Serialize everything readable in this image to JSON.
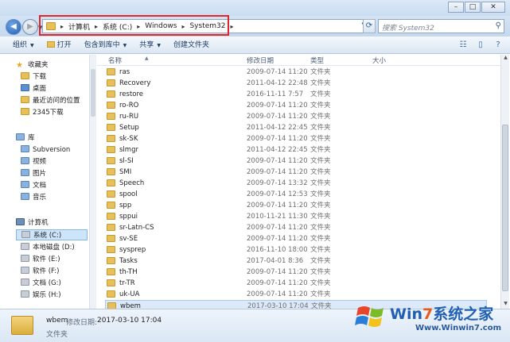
{
  "address": {
    "crumbs": [
      "计算机",
      "系统 (C:)",
      "Windows",
      "System32"
    ]
  },
  "search": {
    "placeholder": "搜索 System32"
  },
  "toolbar": {
    "organize": "组织",
    "open": "打开",
    "include_library": "包含到库中",
    "share": "共享",
    "new_folder": "创建文件夹"
  },
  "nav": {
    "favorites": "收藏夹",
    "downloads": "下载",
    "desktop": "桌面",
    "recent": "最近访问的位置",
    "dl2345": "2345下载",
    "libraries": "库",
    "subversion": "Subversion",
    "videos": "视频",
    "pictures": "图片",
    "documents": "文档",
    "music": "音乐",
    "computer": "计算机",
    "drive_c": "系统 (C:)",
    "drive_d": "本地磁盘 (D:)",
    "drive_e": "软件 (E:)",
    "drive_f": "软件 (F:)",
    "drive_g": "文档 (G:)",
    "drive_h": "娱乐 (H:)"
  },
  "columns": {
    "name": "名称",
    "date": "修改日期",
    "type": "类型",
    "size": "大小"
  },
  "files": [
    {
      "name": "ras",
      "date": "2009-07-14 11:20",
      "type": "文件夹"
    },
    {
      "name": "Recovery",
      "date": "2011-04-12 22:48",
      "type": "文件夹"
    },
    {
      "name": "restore",
      "date": "2016-11-11 7:57",
      "type": "文件夹"
    },
    {
      "name": "ro-RO",
      "date": "2009-07-14 11:20",
      "type": "文件夹"
    },
    {
      "name": "ru-RU",
      "date": "2009-07-14 11:20",
      "type": "文件夹"
    },
    {
      "name": "Setup",
      "date": "2011-04-12 22:45",
      "type": "文件夹"
    },
    {
      "name": "sk-SK",
      "date": "2009-07-14 11:20",
      "type": "文件夹"
    },
    {
      "name": "slmgr",
      "date": "2011-04-12 22:45",
      "type": "文件夹"
    },
    {
      "name": "sl-SI",
      "date": "2009-07-14 11:20",
      "type": "文件夹"
    },
    {
      "name": "SMI",
      "date": "2009-07-14 11:20",
      "type": "文件夹"
    },
    {
      "name": "Speech",
      "date": "2009-07-14 13:32",
      "type": "文件夹"
    },
    {
      "name": "spool",
      "date": "2009-07-14 12:53",
      "type": "文件夹"
    },
    {
      "name": "spp",
      "date": "2009-07-14 11:20",
      "type": "文件夹"
    },
    {
      "name": "sppui",
      "date": "2010-11-21 11:30",
      "type": "文件夹"
    },
    {
      "name": "sr-Latn-CS",
      "date": "2009-07-14 11:20",
      "type": "文件夹"
    },
    {
      "name": "sv-SE",
      "date": "2009-07-14 11:20",
      "type": "文件夹"
    },
    {
      "name": "sysprep",
      "date": "2016-11-10 18:00",
      "type": "文件夹"
    },
    {
      "name": "Tasks",
      "date": "2017-04-01 8:36",
      "type": "文件夹"
    },
    {
      "name": "th-TH",
      "date": "2009-07-14 11:20",
      "type": "文件夹"
    },
    {
      "name": "tr-TR",
      "date": "2009-07-14 11:20",
      "type": "文件夹"
    },
    {
      "name": "uk-UA",
      "date": "2009-07-14 11:20",
      "type": "文件夹"
    },
    {
      "name": "wbem",
      "date": "2017-03-10 17:04",
      "type": "文件夹"
    }
  ],
  "details": {
    "name": "wbem",
    "date_label": "修改日期:",
    "date": "2017-03-10 17:04",
    "type": "文件夹"
  },
  "watermark": {
    "brand_a": "Win",
    "brand_b": "7",
    "brand_c": "系统之家",
    "url": "Www.Winwin7.com"
  }
}
